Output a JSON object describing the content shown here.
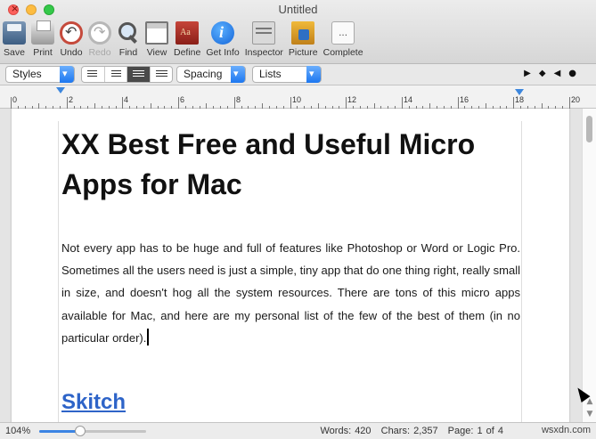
{
  "window": {
    "title": "Untitled"
  },
  "toolbar": {
    "items": [
      {
        "label": "Save",
        "icon": "save-icon",
        "enabled": true
      },
      {
        "label": "Print",
        "icon": "printer-icon",
        "enabled": true
      },
      {
        "label": "Undo",
        "icon": "undo-icon",
        "enabled": true
      },
      {
        "label": "Redo",
        "icon": "redo-icon",
        "enabled": false
      },
      {
        "label": "Find",
        "icon": "magnifier-icon",
        "enabled": true
      },
      {
        "label": "View",
        "icon": "view-icon",
        "enabled": true
      },
      {
        "label": "Define",
        "icon": "dictionary-icon",
        "enabled": true
      },
      {
        "label": "Get Info",
        "icon": "info-icon",
        "enabled": true
      },
      {
        "label": "Inspector",
        "icon": "inspector-icon",
        "enabled": true
      },
      {
        "label": "Picture",
        "icon": "picture-icon",
        "enabled": true
      },
      {
        "label": "Complete",
        "icon": "complete-icon",
        "enabled": true
      }
    ]
  },
  "format_bar": {
    "styles": "Styles",
    "spacing": "Spacing",
    "lists": "Lists",
    "alignment_selected": "justify",
    "ruler_controls": [
      "▶",
      "◆",
      "◀",
      "●"
    ]
  },
  "ruler": {
    "numbers": [
      "0",
      "2",
      "4",
      "6",
      "8",
      "10",
      "12",
      "14",
      "16",
      "18",
      "20"
    ]
  },
  "document": {
    "title": "XX Best Free and Useful Micro Apps for Mac",
    "body": "Not every app has to be huge and full of features like Photoshop or Word or Logic Pro. Sometimes all the users need is just a simple, tiny app that do one thing right, really small in size, and doesn't hog all the system resources. There are tons of this micro apps available for Mac, and here are my personal list of the few of the best of them (in no particular order).",
    "heading": "Skitch"
  },
  "status": {
    "zoom": "104%",
    "zoom_slider_fraction": 0.38,
    "words": "Words: 420",
    "chars": "Chars: 2,357",
    "page": "Page: 1 of 4",
    "watermark": "wsxdn.com"
  },
  "colors": {
    "accent": "#1d77f0",
    "link": "#2e64c8"
  }
}
